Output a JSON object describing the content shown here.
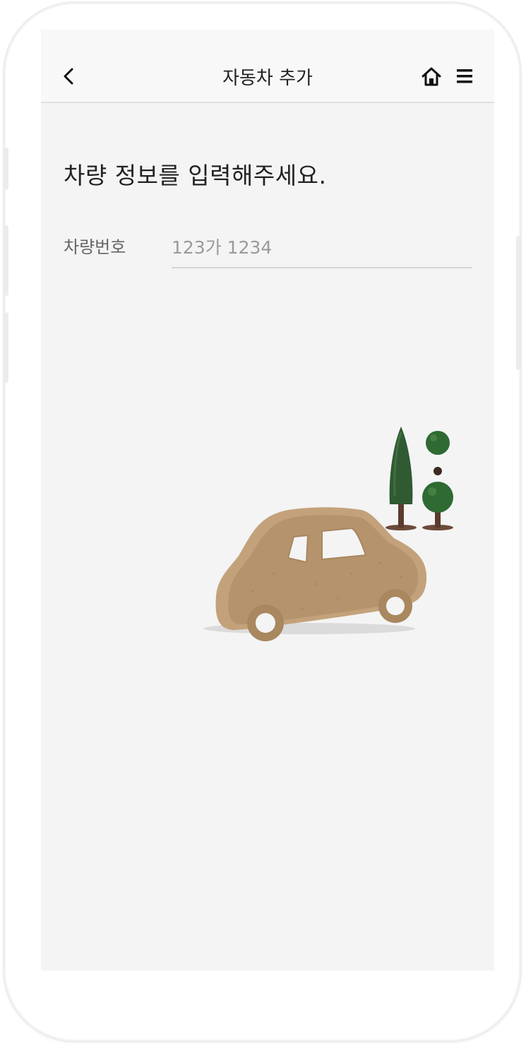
{
  "header": {
    "title": "자동차 추가",
    "back_icon": "chevron-left-icon",
    "home_icon": "home-icon",
    "menu_icon": "hamburger-menu-icon"
  },
  "main": {
    "heading": "차량 정보를 입력해주세요.",
    "plate": {
      "label": "차량번호",
      "value": "",
      "placeholder": "123가 1234"
    },
    "illustration": "wooden-toy-car-with-trees"
  },
  "colors": {
    "screen_bg": "#f4f4f4",
    "header_bg": "#f8f8f8",
    "text": "#222222",
    "muted": "#9a9a9a",
    "wood": "#bfa07c",
    "tree": "#2f5a32"
  }
}
